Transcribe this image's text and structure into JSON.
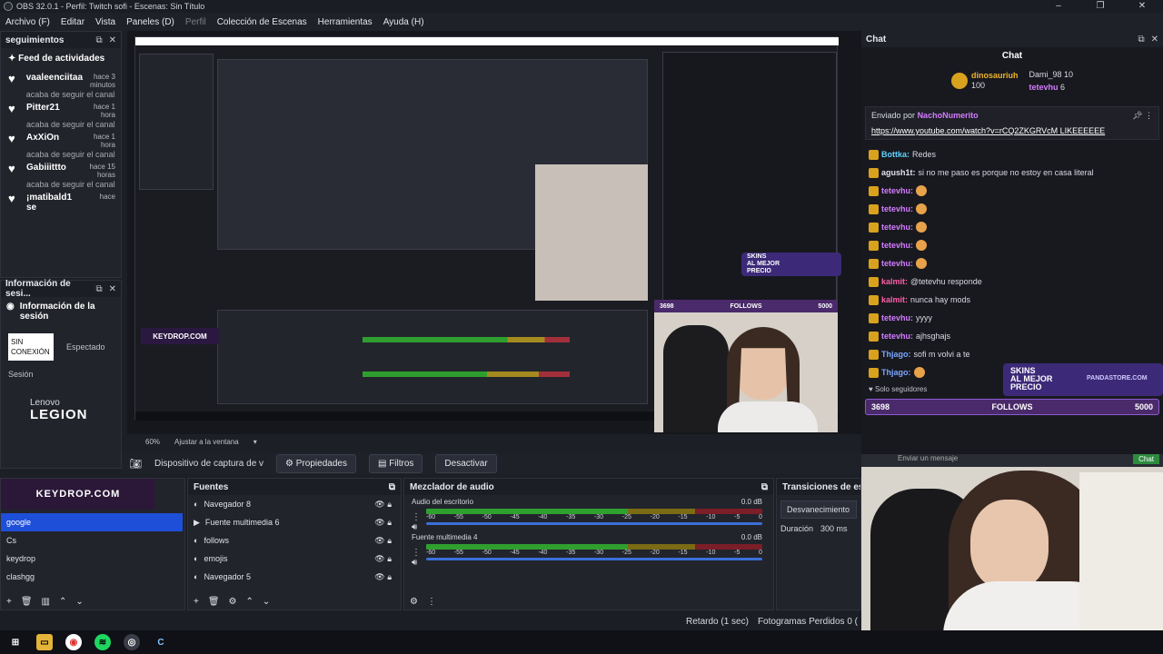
{
  "window": {
    "title": "OBS 32.0.1 - Perfil: Twitch sofi - Escenas: Sin Título"
  },
  "menu": {
    "items": [
      "Archivo (F)",
      "Editar",
      "Vista",
      "Paneles (D)",
      "Perfil",
      "Colección de Escenas",
      "Herramientas",
      "Ayuda (H)"
    ]
  },
  "follows_dock": {
    "title": "seguimientos",
    "feed_title": "Feed de actividades",
    "items": [
      {
        "name": "vaaleenciitaa",
        "time": "hace 3 minutos",
        "action": "acaba de seguir el canal"
      },
      {
        "name": "Pitter21",
        "time": "hace 1 hora",
        "action": "acaba de seguir el canal"
      },
      {
        "name": "AxXiOn",
        "time": "hace 1 hora",
        "action": "acaba de seguir el canal"
      },
      {
        "name": "Gabiiittto",
        "time": "hace 15 horas",
        "action": "acaba de seguir el canal"
      },
      {
        "name": "¡matibald1 se",
        "time": "hace",
        "action": ""
      }
    ]
  },
  "session_dock": {
    "title": "Información de sesi...",
    "heading": "Información de la sesión",
    "status": "SIN CONEXIÓN",
    "expected": "Espectado",
    "session": "Sesión"
  },
  "brand": {
    "lenovo": "Lenovo",
    "legion": "LEGION",
    "keydrop": "KEYDROP.COM"
  },
  "preview": {
    "zoom": "60%",
    "fit": "Ajustar a la ventana"
  },
  "source_toolbar": {
    "source": "Dispositivo de captura de v",
    "properties": "Propiedades",
    "filters": "Filtros",
    "deactivate": "Desactivar"
  },
  "scenes": {
    "items": [
      "google",
      "Cs",
      "keydrop",
      "clashgg"
    ],
    "selected": 0
  },
  "sources": {
    "title": "Fuentes",
    "items": [
      "Navegador 8",
      "Fuente multimedia 6",
      "follows",
      "emojis",
      "Navegador 5"
    ]
  },
  "mixer": {
    "title": "Mezclador de audio",
    "channels": [
      {
        "name": "Audio del escritorio",
        "db": "0.0 dB"
      },
      {
        "name": "Fuente multimedia 4",
        "db": "0.0 dB"
      }
    ],
    "scale": [
      "-60",
      "-55",
      "-50",
      "-45",
      "-40",
      "-35",
      "-30",
      "-25",
      "-20",
      "-15",
      "-10",
      "-5",
      "0"
    ]
  },
  "transitions": {
    "title": "Transiciones de esce",
    "type": "Desvanecimiento",
    "duration_label": "Duración",
    "duration": "300 ms"
  },
  "status": {
    "delay": "Retardo (1 sec)",
    "dropped": "Fotogramas Perdidos 0 ("
  },
  "chat": {
    "dock_title": "Chat",
    "header": "Chat",
    "leaders": [
      {
        "name": "dinosauriuh",
        "value": "100"
      },
      {
        "name": "Dami_98",
        "value": "10"
      },
      {
        "name": "tetevhu",
        "value": "6"
      }
    ],
    "pinned_by": "Enviado por",
    "pinned_user": "NachoNumerito",
    "pinned_url": "https://www.youtube.com/watch?v=rCQ2ZKGRVcM LIKEEEEEE",
    "messages": [
      {
        "user": "Bottka:",
        "text": "Redes",
        "color": "#5fd3ff"
      },
      {
        "user": "agush1t:",
        "text": "si no me paso es porque no estoy en casa literal",
        "color": "#e1e4ea"
      },
      {
        "user": "tetevhu:",
        "text": "",
        "color": "#d37cff"
      },
      {
        "user": "tetevhu:",
        "text": "",
        "color": "#d37cff"
      },
      {
        "user": "tetevhu:",
        "text": "",
        "color": "#d37cff"
      },
      {
        "user": "tetevhu:",
        "text": "",
        "color": "#d37cff"
      },
      {
        "user": "tetevhu:",
        "text": "",
        "color": "#d37cff"
      },
      {
        "user": "kalmit:",
        "text": "@tetevhu responde",
        "color": "#ff5ea8"
      },
      {
        "user": "kalmit:",
        "text": "nunca hay mods",
        "color": "#ff5ea8"
      },
      {
        "user": "tetevhu:",
        "text": "yyyy",
        "color": "#d37cff"
      },
      {
        "user": "tetevhu:",
        "text": "ajhsghajs",
        "color": "#d37cff"
      },
      {
        "user": "Thjago:",
        "text": "sofi m volvi a te",
        "color": "#7aa7ff"
      },
      {
        "user": "Thjago:",
        "text": "",
        "color": "#7aa7ff"
      }
    ],
    "followers_only": "Solo seguidores",
    "input_placeholder": "Enviar un mensaje",
    "chat_button": "Chat"
  },
  "overlay": {
    "count": "3698",
    "label": "FOLLOWS",
    "goal": "5000",
    "skins1": "SKINS",
    "skins2": "AL MEJOR",
    "skins3": "PRECIO",
    "store": "PANDASTORE.COM"
  },
  "colors": {
    "accent": "#1e4fd8",
    "green": "#3fc43f",
    "purple": "#9147ff"
  }
}
